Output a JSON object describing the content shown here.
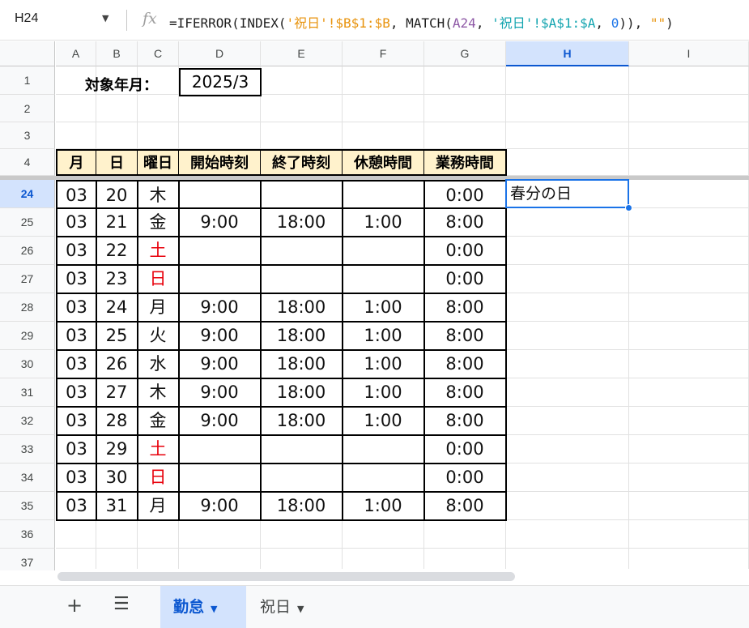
{
  "namebox": "H24",
  "formula": {
    "prefix": "=IFERROR(INDEX(",
    "s1": "'祝日'!$B$1:$B",
    "mid1": ", MATCH(",
    "ref": "A24",
    "mid2": ", ",
    "s2": "'祝日'!$A$1:$A",
    "mid3": ", ",
    "num": "0",
    "mid4": ")), ",
    "s3": "\"\"",
    "suffix": ")"
  },
  "columns": [
    "A",
    "B",
    "C",
    "D",
    "E",
    "F",
    "G",
    "H",
    "I"
  ],
  "selected_column": "H",
  "row_numbers": [
    "1",
    "2",
    "3",
    "4",
    "24",
    "25",
    "26",
    "27",
    "28",
    "29",
    "30",
    "31",
    "32",
    "33",
    "34",
    "35",
    "36",
    "37"
  ],
  "selected_row": "24",
  "title": {
    "label": "対象年月：",
    "value": "2025/3"
  },
  "headers": [
    "月",
    "日",
    "曜日",
    "開始時刻",
    "終了時刻",
    "休憩時間",
    "業務時間"
  ],
  "rows": [
    {
      "month": "03",
      "day": "20",
      "weekday": "木",
      "start": "",
      "end": "",
      "break": "",
      "work": "0:00",
      "weekend": false
    },
    {
      "month": "03",
      "day": "21",
      "weekday": "金",
      "start": "9:00",
      "end": "18:00",
      "break": "1:00",
      "work": "8:00",
      "weekend": false
    },
    {
      "month": "03",
      "day": "22",
      "weekday": "土",
      "start": "",
      "end": "",
      "break": "",
      "work": "0:00",
      "weekend": true
    },
    {
      "month": "03",
      "day": "23",
      "weekday": "日",
      "start": "",
      "end": "",
      "break": "",
      "work": "0:00",
      "weekend": true
    },
    {
      "month": "03",
      "day": "24",
      "weekday": "月",
      "start": "9:00",
      "end": "18:00",
      "break": "1:00",
      "work": "8:00",
      "weekend": false
    },
    {
      "month": "03",
      "day": "25",
      "weekday": "火",
      "start": "9:00",
      "end": "18:00",
      "break": "1:00",
      "work": "8:00",
      "weekend": false
    },
    {
      "month": "03",
      "day": "26",
      "weekday": "水",
      "start": "9:00",
      "end": "18:00",
      "break": "1:00",
      "work": "8:00",
      "weekend": false
    },
    {
      "month": "03",
      "day": "27",
      "weekday": "木",
      "start": "9:00",
      "end": "18:00",
      "break": "1:00",
      "work": "8:00",
      "weekend": false
    },
    {
      "month": "03",
      "day": "28",
      "weekday": "金",
      "start": "9:00",
      "end": "18:00",
      "break": "1:00",
      "work": "8:00",
      "weekend": false
    },
    {
      "month": "03",
      "day": "29",
      "weekday": "土",
      "start": "",
      "end": "",
      "break": "",
      "work": "0:00",
      "weekend": true
    },
    {
      "month": "03",
      "day": "30",
      "weekday": "日",
      "start": "",
      "end": "",
      "break": "",
      "work": "0:00",
      "weekend": true
    },
    {
      "month": "03",
      "day": "31",
      "weekday": "月",
      "start": "9:00",
      "end": "18:00",
      "break": "1:00",
      "work": "8:00",
      "weekend": false
    }
  ],
  "selected_cell_value": "春分の日",
  "sheet_tabs": [
    {
      "name": "勤怠",
      "active": true
    },
    {
      "name": "祝日",
      "active": false
    }
  ],
  "icons": {
    "add_sheet": "plus-icon",
    "all_sheets": "menu-icon"
  },
  "colors": {
    "header_fill": "#fff2cc",
    "weekend_text": "#e8000b",
    "selection": "#1a73e8",
    "active_tab": "#d3e3fd"
  }
}
